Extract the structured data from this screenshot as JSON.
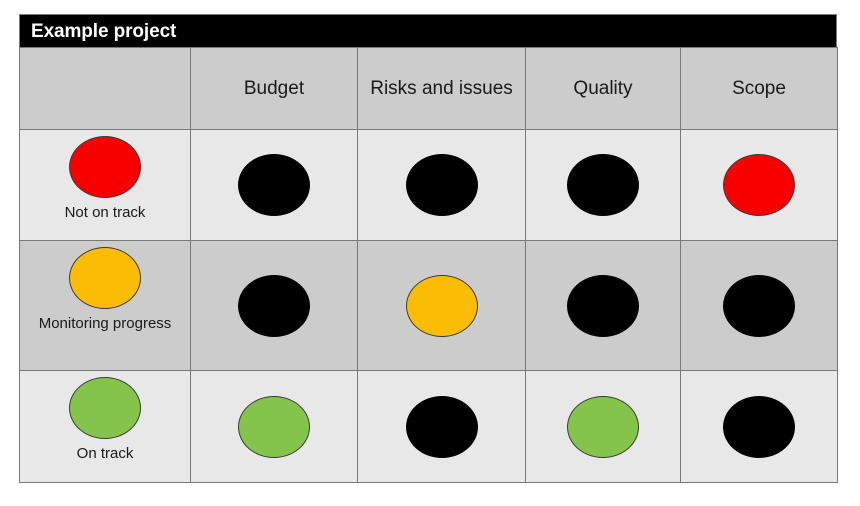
{
  "title": {
    "text": "Example project"
  },
  "colors": {
    "red": "#f90000",
    "amber": "#fbbc06",
    "green": "#84c44a",
    "black": "#000000",
    "title_bar_bg": "#000000",
    "title_bar_text": "#ffffff",
    "header_bg": "#cccccc",
    "row_light_bg": "#e8e8e8",
    "row_dark_bg": "#cccccc",
    "grid_line": "#787878"
  },
  "table": {
    "corner_header": "",
    "columns": [
      {
        "key": "budget",
        "label": "Budget"
      },
      {
        "key": "risks",
        "label": "Risks and issues"
      },
      {
        "key": "quality",
        "label": "Quality"
      },
      {
        "key": "scope",
        "label": "Scope"
      }
    ],
    "rows": [
      {
        "legend_label": "Not on track",
        "legend_status": "red",
        "cells": [
          {
            "column": "budget",
            "status": "black"
          },
          {
            "column": "risks",
            "status": "black"
          },
          {
            "column": "quality",
            "status": "black"
          },
          {
            "column": "scope",
            "status": "red"
          }
        ]
      },
      {
        "legend_label": "Monitoring progress",
        "legend_status": "amber",
        "cells": [
          {
            "column": "budget",
            "status": "black"
          },
          {
            "column": "risks",
            "status": "amber"
          },
          {
            "column": "quality",
            "status": "black"
          },
          {
            "column": "scope",
            "status": "black"
          }
        ]
      },
      {
        "legend_label": "On track",
        "legend_status": "green",
        "cells": [
          {
            "column": "budget",
            "status": "green"
          },
          {
            "column": "risks",
            "status": "black"
          },
          {
            "column": "quality",
            "status": "green"
          },
          {
            "column": "scope",
            "status": "black"
          }
        ]
      }
    ]
  }
}
